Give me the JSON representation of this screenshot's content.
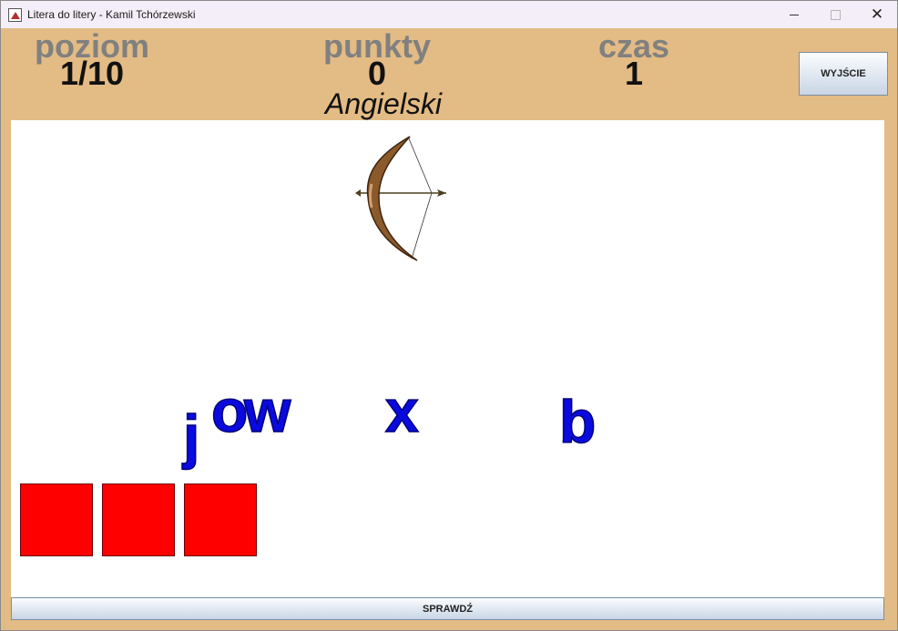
{
  "window": {
    "title": "Litera do litery - Kamil Tchórzewski"
  },
  "stats": {
    "level_label": "poziom",
    "level_value": "1/10",
    "points_label": "punkty",
    "points_value": "0",
    "time_label": "czas",
    "time_value": "1"
  },
  "language": "Angielski",
  "buttons": {
    "exit": "WYJŚCIE",
    "check": "SPRAWDŹ"
  },
  "picture": {
    "subject": "bow-and-arrow"
  },
  "letters": [
    "j",
    "o",
    "w",
    "x",
    "b"
  ],
  "answer_slots": {
    "count": 3,
    "color": "#ff0000"
  },
  "colors": {
    "background": "#e3bb84",
    "letter": "#0a0ae0",
    "label": "#808080"
  }
}
